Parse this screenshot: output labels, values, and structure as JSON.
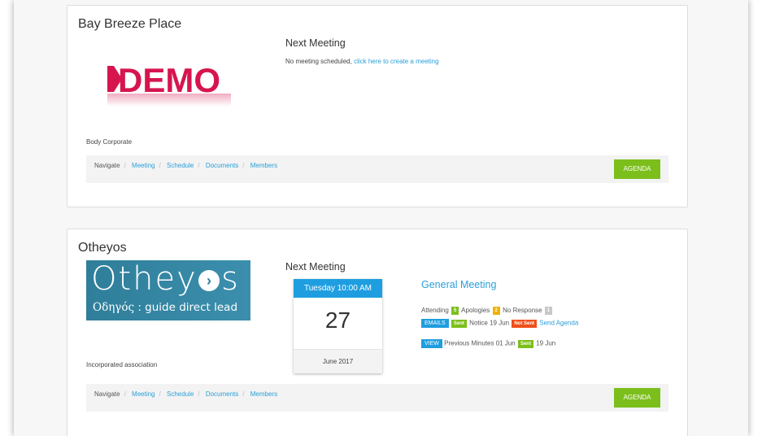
{
  "cards": [
    {
      "title": "Bay Breeze Place",
      "logo_text": "DEMO",
      "type": "Body Corporate",
      "next_meeting_label": "Next Meeting",
      "no_meeting_text": "No meeting scheduled,",
      "create_link": "click here to create a meeting",
      "nav": {
        "label": "Navigate",
        "links": [
          "Meeting",
          "Schedule",
          "Documents",
          "Members"
        ]
      },
      "agenda_label": "AGENDA"
    },
    {
      "title": "Otheyos",
      "logo_big": "Otheyo",
      "logo_big_end": "s",
      "logo_small_greek": "Οδηγός",
      "logo_small_rest": ": guide direct lead",
      "type": "Incorporated association",
      "next_meeting_label": "Next Meeting",
      "calendar": {
        "header": "Tuesday 10:00 AM",
        "day": "27",
        "month": "June 2017"
      },
      "meeting_title": "General Meeting",
      "attending_label": "Attending",
      "attending_count": "5",
      "apologies_label": "Apologies",
      "apologies_count": "2",
      "noresponse_label": "No Response",
      "noresponse_count": "1",
      "emails_button": "EMAILS",
      "sent_badge": "Sent",
      "notice_text": "Notice 19 Jun",
      "notsent_badge": "Not Sent",
      "send_agenda": "Send Agenda",
      "view_button": "VIEW",
      "prev_minutes_text": "Previous Minutes 01 Jun",
      "sent_badge2": "Sent",
      "prev_sent_date": "19 Jun",
      "nav": {
        "label": "Navigate",
        "links": [
          "Meeting",
          "Schedule",
          "Documents",
          "Members"
        ]
      },
      "agenda_label": "AGENDA"
    }
  ],
  "colors": {
    "accent": "#2b9fd8",
    "agenda_green": "#7cbf1c",
    "calendar_blue": "#1e9ee0",
    "demo_red": "#d6154f"
  }
}
